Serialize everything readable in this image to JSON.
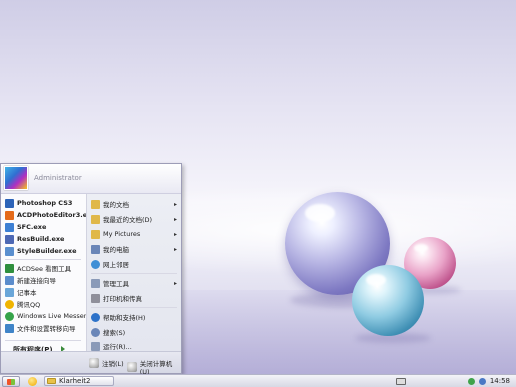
{
  "user": {
    "name": "Administrator"
  },
  "pinned": [
    {
      "label": "Photoshop CS3",
      "color": "#2c63b8",
      "name": "photoshop-icon"
    },
    {
      "label": "ACDPhotoEditor3.exe",
      "color": "#e46a1a",
      "name": "acdphotoeditor-icon"
    },
    {
      "label": "SFC.exe",
      "color": "#3c7fd3",
      "name": "sfc-icon"
    },
    {
      "label": "ResBuild.exe",
      "color": "#4d68b4",
      "name": "resbuild-icon"
    },
    {
      "label": "StyleBuilder.exe",
      "color": "#5a8fcf",
      "name": "stylebuilder-icon"
    }
  ],
  "recent": [
    {
      "label": "ACDSee 看图工具",
      "color": "#2f8f3e",
      "name": "acdsee-icon"
    },
    {
      "label": "新建连接向导",
      "color": "#5b8ccc",
      "name": "network-wizard-icon"
    },
    {
      "label": "记事本",
      "color": "#6aa6d9",
      "name": "notepad-icon"
    },
    {
      "label": "腾讯QQ",
      "color": "#f0b400",
      "name": "qq-icon"
    },
    {
      "label": "Windows Live Messenger",
      "color": "#35a34a",
      "name": "messenger-icon"
    },
    {
      "label": "文件和设置转移向导",
      "color": "#3f84c8",
      "name": "transfer-wizard-icon"
    }
  ],
  "all_programs": "所有程序(P)",
  "right_items": [
    {
      "label": "我的文档",
      "color": "#e0b84a",
      "name": "my-documents-icon",
      "arrow": true
    },
    {
      "label": "我最近的文档(D)",
      "color": "#e0b84a",
      "name": "recent-documents-icon",
      "arrow": true
    },
    {
      "label": "My Pictures",
      "color": "#e0b84a",
      "name": "my-pictures-icon",
      "arrow": true
    },
    {
      "label": "我的电脑",
      "color": "#6a86b8",
      "name": "my-computer-icon",
      "arrow": true
    },
    {
      "label": "网上邻居",
      "color": "#3f8fd6",
      "name": "network-places-icon",
      "arrow": false
    },
    {
      "label": "管理工具",
      "color": "#8a9ab8",
      "name": "admin-tools-icon",
      "arrow": true
    },
    {
      "label": "打印机和传真",
      "color": "#8f8f9a",
      "name": "printers-icon",
      "arrow": false
    },
    {
      "label": "帮助和支持(H)",
      "color": "#2d72c9",
      "name": "help-icon",
      "arrow": false
    },
    {
      "label": "搜索(S)",
      "color": "#6a86b8",
      "name": "search-icon",
      "arrow": false
    },
    {
      "label": "运行(R)...",
      "color": "#8a9ab8",
      "name": "run-icon",
      "arrow": false
    }
  ],
  "footer": {
    "logoff": "注销(L)",
    "shutdown": "关闭计算机(U)"
  },
  "taskbar": {
    "window": "Klarheit2",
    "clock": "14:58"
  }
}
